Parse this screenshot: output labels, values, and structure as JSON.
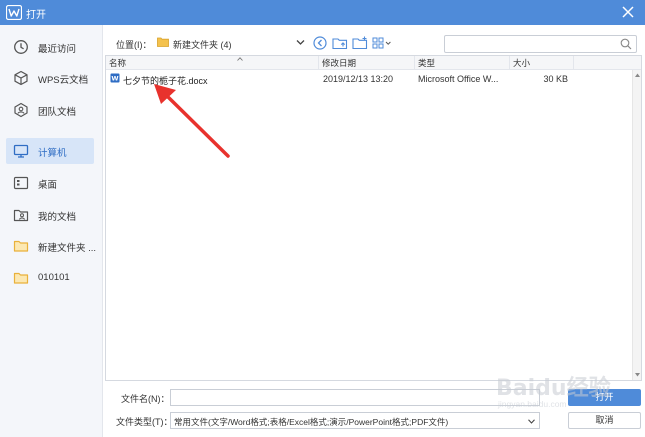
{
  "window": {
    "title": "打开",
    "accent": "#4f8bd9"
  },
  "sidebar": {
    "items": [
      {
        "label": "最近访问",
        "icon": "clock-icon",
        "active": false
      },
      {
        "label": "WPS云文档",
        "icon": "cube-icon",
        "active": false
      },
      {
        "label": "团队文档",
        "icon": "team-icon",
        "active": false
      },
      {
        "label": "计算机",
        "icon": "computer-icon",
        "active": true
      },
      {
        "label": "桌面",
        "icon": "desktop-icon",
        "active": false
      },
      {
        "label": "我的文档",
        "icon": "user-folder-icon",
        "active": false
      },
      {
        "label": "新建文件夹 ...",
        "icon": "folder-icon",
        "active": false
      },
      {
        "label": "010101",
        "icon": "folder-icon",
        "active": false
      }
    ]
  },
  "location": {
    "label": "位置(I)：",
    "path": "新建文件夹 (4)"
  },
  "search": {
    "placeholder": ""
  },
  "file_list": {
    "columns": [
      "名称",
      "修改日期",
      "类型",
      "大小"
    ],
    "rows": [
      {
        "name": "七夕节的栀子花.docx",
        "modified": "2019/12/13 13:20",
        "type": "Microsoft Office W...",
        "size": "30 KB"
      }
    ]
  },
  "bottom": {
    "filename_label": "文件名(N)：",
    "filename_value": "",
    "filetype_label": "文件类型(T)：",
    "filetype_value": "常用文件(文字/Word格式;表格/Excel格式;演示/PowerPoint格式;PDF文件)",
    "open_label": "打开",
    "cancel_label": "取消"
  },
  "watermark": {
    "text": "Baidu经验",
    "sub": "jingyan.baidu.com"
  }
}
